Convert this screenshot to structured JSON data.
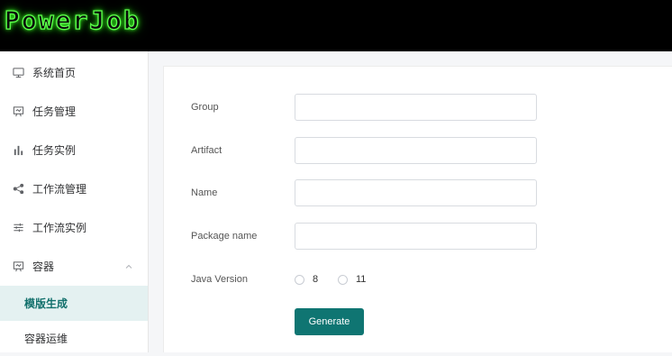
{
  "app": {
    "logo_text": "PowerJob"
  },
  "sidebar": {
    "items": [
      {
        "label": "系统首页",
        "icon": "monitor-icon"
      },
      {
        "label": "任务管理",
        "icon": "presentation-icon"
      },
      {
        "label": "任务实例",
        "icon": "bar-chart-icon"
      },
      {
        "label": "工作流管理",
        "icon": "share-icon"
      },
      {
        "label": "工作流实例",
        "icon": "sliders-icon"
      },
      {
        "label": "容器",
        "icon": "presentation-icon",
        "expanded": true
      }
    ],
    "sub_items": [
      {
        "label": "模版生成",
        "active": true
      },
      {
        "label": "容器运维",
        "active": false
      }
    ]
  },
  "form": {
    "group_label": "Group",
    "group_value": "",
    "artifact_label": "Artifact",
    "artifact_value": "",
    "name_label": "Name",
    "name_value": "",
    "package_label": "Package name",
    "package_value": "",
    "java_version_label": "Java Version",
    "java_options": [
      "8",
      "11"
    ],
    "generate_label": "Generate"
  },
  "colors": {
    "accent": "#0f7572",
    "active_bg": "#e4f1f1",
    "logo_glow": "#3cff2a"
  }
}
